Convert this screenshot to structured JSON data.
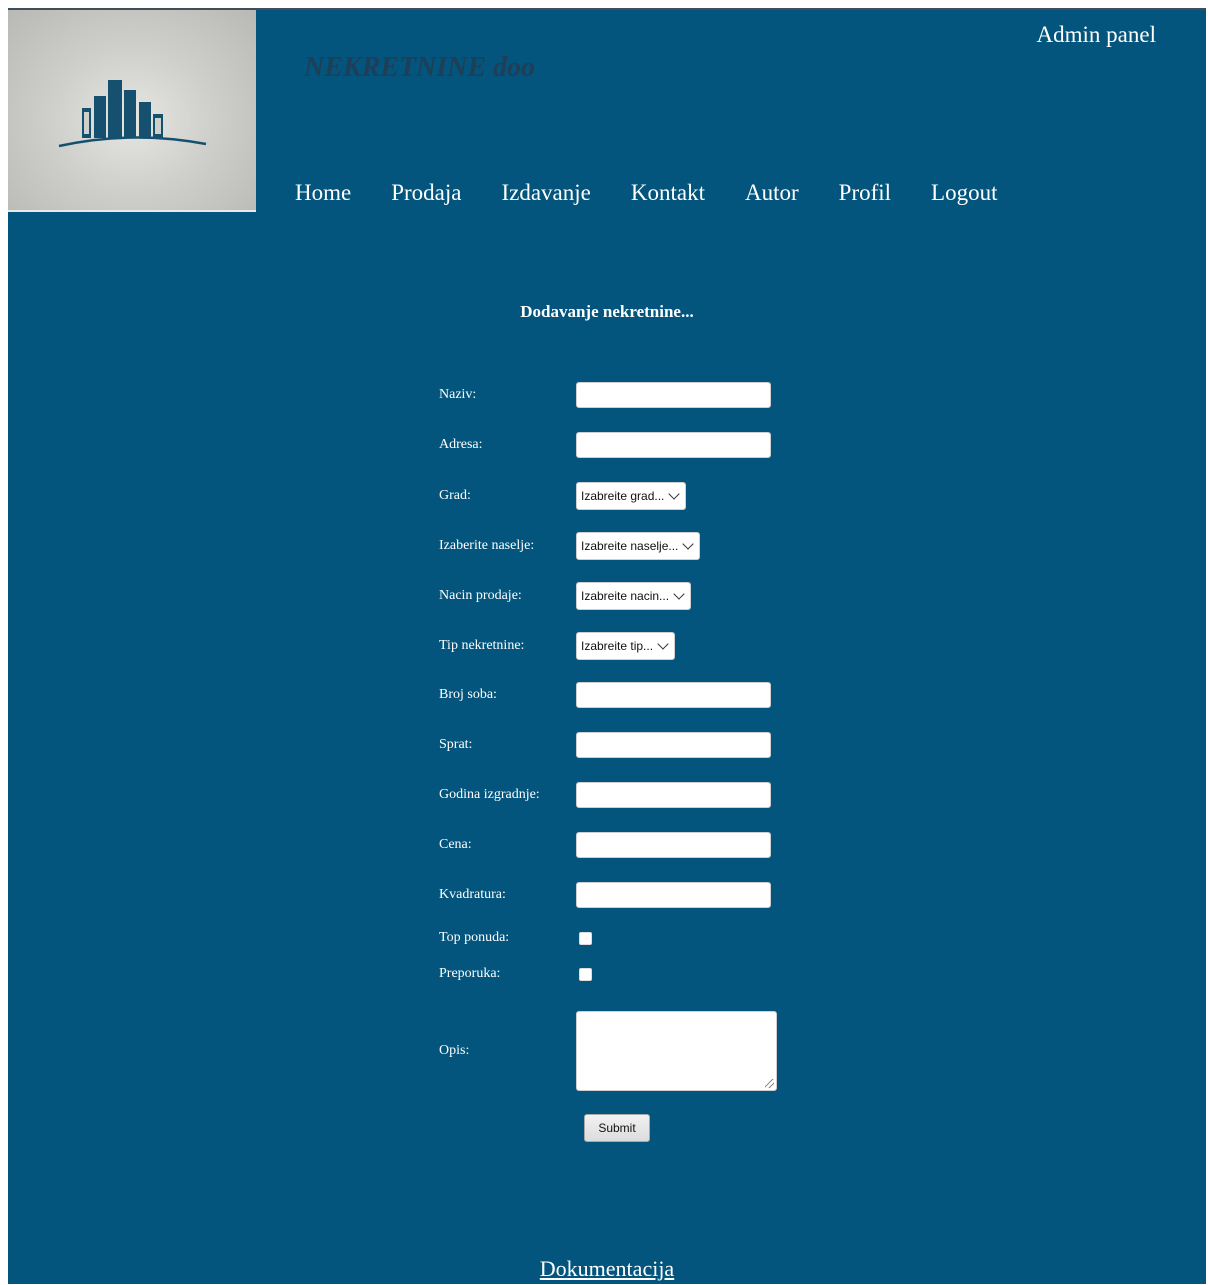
{
  "header": {
    "brand": "NEKRETNINE doo",
    "admin_panel": "Admin panel",
    "logo_icon": "buildings-logo-icon"
  },
  "nav": [
    "Home",
    "Prodaja",
    "Izdavanje",
    "Kontakt",
    "Autor",
    "Profil",
    "Logout"
  ],
  "form": {
    "title": "Dodavanje nekretnine...",
    "fields": {
      "naziv": {
        "label": "Naziv:",
        "value": ""
      },
      "adresa": {
        "label": "Adresa:",
        "value": ""
      },
      "grad": {
        "label": "Grad:",
        "selected": "Izabreite grad..."
      },
      "naselje": {
        "label": "Izaberite naselje:",
        "selected": "Izabreite naselje..."
      },
      "nacin": {
        "label": "Nacin prodaje:",
        "selected": "Izabreite nacin..."
      },
      "tip": {
        "label": "Tip nekretnine:",
        "selected": "Izabreite tip..."
      },
      "broj_soba": {
        "label": "Broj soba:",
        "value": ""
      },
      "sprat": {
        "label": "Sprat:",
        "value": ""
      },
      "godina": {
        "label": "Godina izgradnje:",
        "value": ""
      },
      "cena": {
        "label": "Cena:",
        "value": ""
      },
      "kvadratura": {
        "label": "Kvadratura:",
        "value": ""
      },
      "top_ponuda": {
        "label": "Top ponuda:",
        "checked": false
      },
      "preporuka": {
        "label": "Preporuka:",
        "checked": false
      },
      "opis": {
        "label": "Opis:",
        "value": ""
      }
    },
    "submit_label": "Submit"
  },
  "footer": {
    "link": "Dokumentacija"
  },
  "colors": {
    "background": "#03557d",
    "brand_text": "#1f3e57",
    "logo_bg": "#cfcfcc"
  }
}
